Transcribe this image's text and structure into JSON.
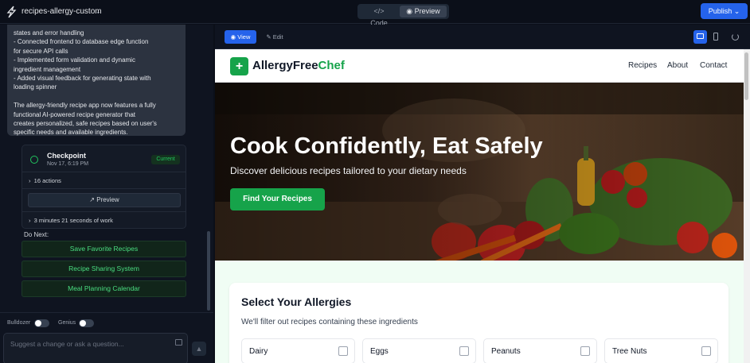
{
  "app": {
    "project_name": "recipes-allergy-custom",
    "tabs": {
      "code": "</> Code",
      "preview": "Preview"
    },
    "publish_label": "Publish"
  },
  "chat": {
    "message_lines": [
      "states and error handling",
      "- Connected frontend to database edge function",
      "for secure API calls",
      "- Implemented form validation and dynamic",
      "ingredient management",
      "- Added visual feedback for generating state with",
      "loading spinner",
      "",
      "The allergy-friendly recipe app now features a fully",
      "functional AI-powered recipe generator that",
      "creates personalized, safe recipes based on user's",
      "specific needs and available ingredients."
    ],
    "checkpoint": {
      "title": "Checkpoint",
      "date": "Nov 17, 6:19 PM",
      "badge": "Current",
      "actions": "16 actions",
      "preview_label": "Preview",
      "work_time": "3 minutes 21 seconds of work"
    },
    "do_next_label": "Do Next:",
    "suggestions": [
      "Save Favorite Recipes",
      "Recipe Sharing System",
      "Meal Planning Calendar"
    ],
    "toggles": {
      "bulldozer": "Bulldozer",
      "genius": "Genius"
    },
    "input_placeholder": "Suggest a change or ask a question..."
  },
  "preview_toolbar": {
    "view_label": "View",
    "edit_label": "Edit"
  },
  "site": {
    "brand_main": "AllergyFree",
    "brand_accent": "Chef",
    "nav": [
      "Recipes",
      "About",
      "Contact"
    ],
    "hero": {
      "title": "Cook Confidently, Eat Safely",
      "subtitle": "Discover delicious recipes tailored to your dietary needs",
      "cta": "Find Your Recipes"
    },
    "allergies": {
      "title": "Select Your Allergies",
      "subtitle": "We'll filter out recipes containing these ingredients",
      "options": [
        "Dairy",
        "Eggs",
        "Peanuts",
        "Tree Nuts"
      ]
    }
  },
  "colors": {
    "accent_blue": "#2563eb",
    "brand_green": "#16a34a"
  }
}
